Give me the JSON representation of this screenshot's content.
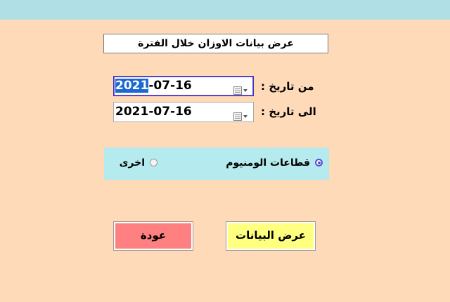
{
  "page": {
    "title": "عرض بيانات الاوزان خلال الفترة"
  },
  "from_date": {
    "label": "من تاريخ :",
    "year_selected": "2021",
    "rest": "-07-16"
  },
  "to_date": {
    "label": "الى تاريخ :",
    "value": "2021-07-16"
  },
  "radio": {
    "options": [
      {
        "label": "قطاعات الومنيوم",
        "checked": true
      },
      {
        "label": "اخرى",
        "checked": false
      }
    ]
  },
  "buttons": {
    "show": "عرض البيانات",
    "back": "عودة"
  },
  "icons": {
    "date_picker": "calendar-dropdown-icon"
  },
  "colors": {
    "background": "#FFDAB8",
    "top_bar": "#B0E0E6",
    "radio_panel": "#B5EAEF",
    "show_button": "#FFFF80",
    "back_button": "#FF8080",
    "selection": "#1b68d1",
    "radio_accent": "#5a4ed1"
  }
}
